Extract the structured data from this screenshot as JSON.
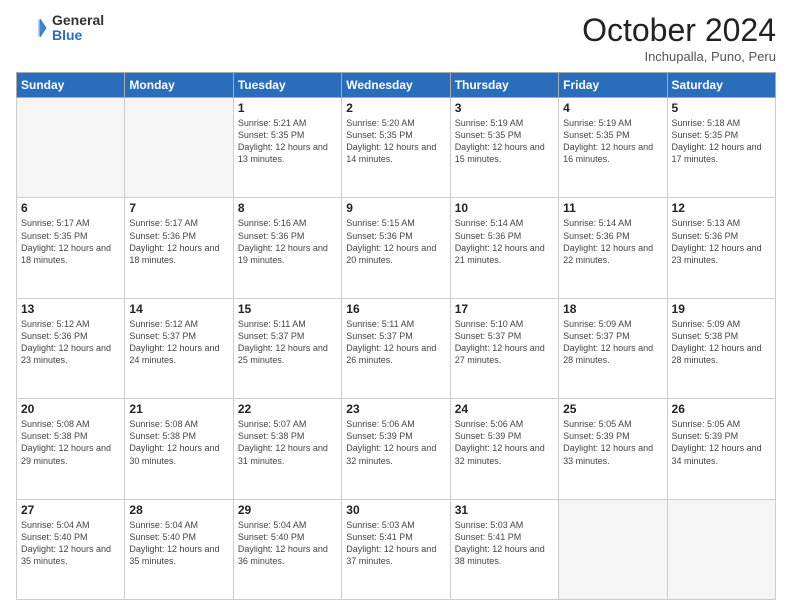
{
  "header": {
    "logo_general": "General",
    "logo_blue": "Blue",
    "month": "October 2024",
    "location": "Inchupalla, Puno, Peru"
  },
  "weekdays": [
    "Sunday",
    "Monday",
    "Tuesday",
    "Wednesday",
    "Thursday",
    "Friday",
    "Saturday"
  ],
  "days": [
    {
      "num": "",
      "info": ""
    },
    {
      "num": "",
      "info": ""
    },
    {
      "num": "1",
      "info": "Sunrise: 5:21 AM\nSunset: 5:35 PM\nDaylight: 12 hours and 13 minutes."
    },
    {
      "num": "2",
      "info": "Sunrise: 5:20 AM\nSunset: 5:35 PM\nDaylight: 12 hours and 14 minutes."
    },
    {
      "num": "3",
      "info": "Sunrise: 5:19 AM\nSunset: 5:35 PM\nDaylight: 12 hours and 15 minutes."
    },
    {
      "num": "4",
      "info": "Sunrise: 5:19 AM\nSunset: 5:35 PM\nDaylight: 12 hours and 16 minutes."
    },
    {
      "num": "5",
      "info": "Sunrise: 5:18 AM\nSunset: 5:35 PM\nDaylight: 12 hours and 17 minutes."
    },
    {
      "num": "6",
      "info": "Sunrise: 5:17 AM\nSunset: 5:35 PM\nDaylight: 12 hours and 18 minutes."
    },
    {
      "num": "7",
      "info": "Sunrise: 5:17 AM\nSunset: 5:36 PM\nDaylight: 12 hours and 18 minutes."
    },
    {
      "num": "8",
      "info": "Sunrise: 5:16 AM\nSunset: 5:36 PM\nDaylight: 12 hours and 19 minutes."
    },
    {
      "num": "9",
      "info": "Sunrise: 5:15 AM\nSunset: 5:36 PM\nDaylight: 12 hours and 20 minutes."
    },
    {
      "num": "10",
      "info": "Sunrise: 5:14 AM\nSunset: 5:36 PM\nDaylight: 12 hours and 21 minutes."
    },
    {
      "num": "11",
      "info": "Sunrise: 5:14 AM\nSunset: 5:36 PM\nDaylight: 12 hours and 22 minutes."
    },
    {
      "num": "12",
      "info": "Sunrise: 5:13 AM\nSunset: 5:36 PM\nDaylight: 12 hours and 23 minutes."
    },
    {
      "num": "13",
      "info": "Sunrise: 5:12 AM\nSunset: 5:36 PM\nDaylight: 12 hours and 23 minutes."
    },
    {
      "num": "14",
      "info": "Sunrise: 5:12 AM\nSunset: 5:37 PM\nDaylight: 12 hours and 24 minutes."
    },
    {
      "num": "15",
      "info": "Sunrise: 5:11 AM\nSunset: 5:37 PM\nDaylight: 12 hours and 25 minutes."
    },
    {
      "num": "16",
      "info": "Sunrise: 5:11 AM\nSunset: 5:37 PM\nDaylight: 12 hours and 26 minutes."
    },
    {
      "num": "17",
      "info": "Sunrise: 5:10 AM\nSunset: 5:37 PM\nDaylight: 12 hours and 27 minutes."
    },
    {
      "num": "18",
      "info": "Sunrise: 5:09 AM\nSunset: 5:37 PM\nDaylight: 12 hours and 28 minutes."
    },
    {
      "num": "19",
      "info": "Sunrise: 5:09 AM\nSunset: 5:38 PM\nDaylight: 12 hours and 28 minutes."
    },
    {
      "num": "20",
      "info": "Sunrise: 5:08 AM\nSunset: 5:38 PM\nDaylight: 12 hours and 29 minutes."
    },
    {
      "num": "21",
      "info": "Sunrise: 5:08 AM\nSunset: 5:38 PM\nDaylight: 12 hours and 30 minutes."
    },
    {
      "num": "22",
      "info": "Sunrise: 5:07 AM\nSunset: 5:38 PM\nDaylight: 12 hours and 31 minutes."
    },
    {
      "num": "23",
      "info": "Sunrise: 5:06 AM\nSunset: 5:39 PM\nDaylight: 12 hours and 32 minutes."
    },
    {
      "num": "24",
      "info": "Sunrise: 5:06 AM\nSunset: 5:39 PM\nDaylight: 12 hours and 32 minutes."
    },
    {
      "num": "25",
      "info": "Sunrise: 5:05 AM\nSunset: 5:39 PM\nDaylight: 12 hours and 33 minutes."
    },
    {
      "num": "26",
      "info": "Sunrise: 5:05 AM\nSunset: 5:39 PM\nDaylight: 12 hours and 34 minutes."
    },
    {
      "num": "27",
      "info": "Sunrise: 5:04 AM\nSunset: 5:40 PM\nDaylight: 12 hours and 35 minutes."
    },
    {
      "num": "28",
      "info": "Sunrise: 5:04 AM\nSunset: 5:40 PM\nDaylight: 12 hours and 35 minutes."
    },
    {
      "num": "29",
      "info": "Sunrise: 5:04 AM\nSunset: 5:40 PM\nDaylight: 12 hours and 36 minutes."
    },
    {
      "num": "30",
      "info": "Sunrise: 5:03 AM\nSunset: 5:41 PM\nDaylight: 12 hours and 37 minutes."
    },
    {
      "num": "31",
      "info": "Sunrise: 5:03 AM\nSunset: 5:41 PM\nDaylight: 12 hours and 38 minutes."
    },
    {
      "num": "",
      "info": ""
    },
    {
      "num": "",
      "info": ""
    }
  ]
}
